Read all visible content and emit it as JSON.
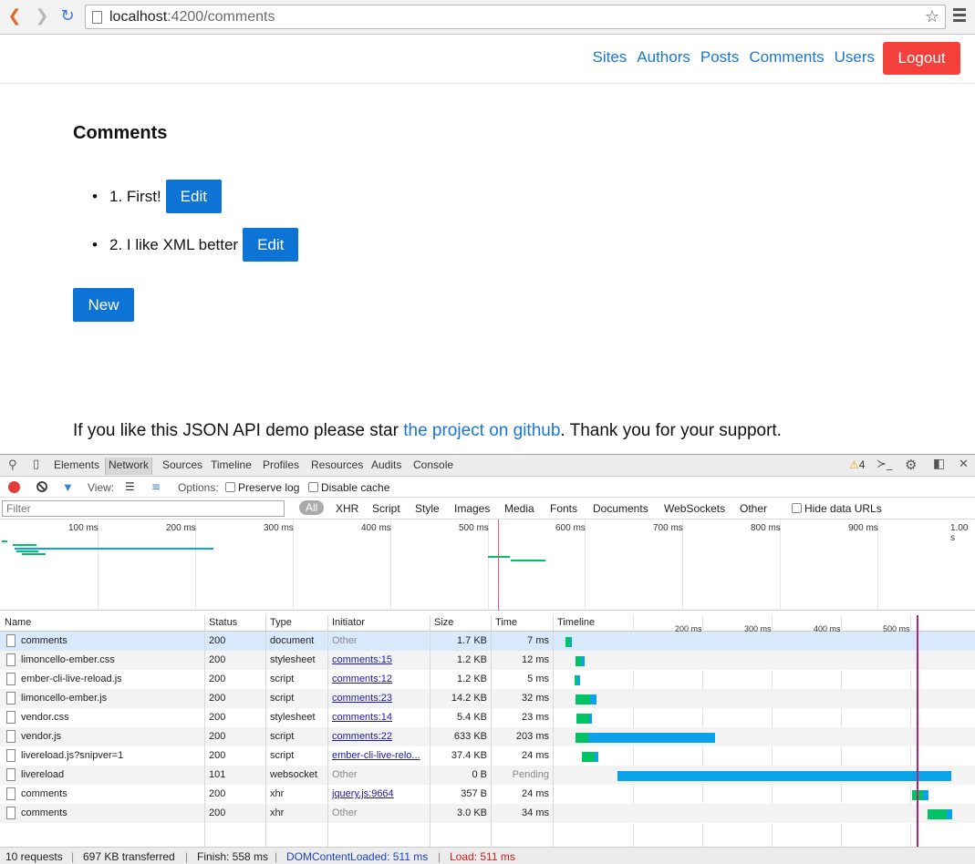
{
  "browser": {
    "url_host": "localhost",
    "url_path": ":4200/comments"
  },
  "navbar": {
    "links": [
      "Sites",
      "Authors",
      "Posts",
      "Comments",
      "Users"
    ],
    "logout_label": "Logout"
  },
  "main": {
    "title": "Comments",
    "comments": [
      {
        "text": "1. First!",
        "edit_label": "Edit"
      },
      {
        "text": "2. I like XML better",
        "edit_label": "Edit"
      }
    ],
    "new_label": "New",
    "footer_before": "If you like this JSON API demo please star ",
    "footer_link": "the project on github",
    "footer_after": ". Thank you for your support."
  },
  "devtools": {
    "tabs": [
      "Elements",
      "Network",
      "Sources",
      "Timeline",
      "Profiles",
      "Resources",
      "Audits",
      "Console"
    ],
    "active_tab": "Network",
    "warning_count": "4",
    "toolbar": {
      "view_label": "View:",
      "options_label": "Options:",
      "preserve_log": "Preserve log",
      "disable_cache": "Disable cache"
    },
    "filter_placeholder": "Filter",
    "type_filters": [
      "All",
      "XHR",
      "Script",
      "Style",
      "Images",
      "Media",
      "Fonts",
      "Documents",
      "WebSockets",
      "Other"
    ],
    "hide_data_urls": "Hide data URLs",
    "overview_ticks": [
      "100 ms",
      "200 ms",
      "300 ms",
      "400 ms",
      "500 ms",
      "600 ms",
      "700 ms",
      "800 ms",
      "900 ms",
      "1.00 s"
    ],
    "columns": [
      "Name",
      "Status",
      "Type",
      "Initiator",
      "Size",
      "Time",
      "Timeline"
    ],
    "timeline_ticks": [
      "200 ms",
      "300 ms",
      "400 ms",
      "500 ms"
    ],
    "requests": [
      {
        "name": "comments",
        "status": "200",
        "type": "document",
        "initiator": "Other",
        "size": "1.7 KB",
        "time": "7 ms"
      },
      {
        "name": "limoncello-ember.css",
        "status": "200",
        "type": "stylesheet",
        "initiator": "comments:15",
        "size": "1.2 KB",
        "time": "12 ms"
      },
      {
        "name": "ember-cli-live-reload.js",
        "status": "200",
        "type": "script",
        "initiator": "comments:12",
        "size": "1.2 KB",
        "time": "5 ms"
      },
      {
        "name": "limoncello-ember.js",
        "status": "200",
        "type": "script",
        "initiator": "comments:23",
        "size": "14.2 KB",
        "time": "32 ms"
      },
      {
        "name": "vendor.css",
        "status": "200",
        "type": "stylesheet",
        "initiator": "comments:14",
        "size": "5.4 KB",
        "time": "23 ms"
      },
      {
        "name": "vendor.js",
        "status": "200",
        "type": "script",
        "initiator": "comments:22",
        "size": "633 KB",
        "time": "203 ms"
      },
      {
        "name": "livereload.js?snipver=1",
        "status": "200",
        "type": "script",
        "initiator": "ember-cli-live-relo...",
        "size": "37.4 KB",
        "time": "24 ms"
      },
      {
        "name": "livereload",
        "status": "101",
        "type": "websocket",
        "initiator": "Other",
        "size": "0 B",
        "time": "Pending"
      },
      {
        "name": "comments",
        "status": "200",
        "type": "xhr",
        "initiator": "jquery.js:9664",
        "size": "357 B",
        "time": "24 ms"
      },
      {
        "name": "comments",
        "status": "200",
        "type": "xhr",
        "initiator": "Other",
        "size": "3.0 KB",
        "time": "34 ms"
      }
    ],
    "status": {
      "requests": "10 requests",
      "transferred": "697 KB transferred",
      "finish": "Finish: 558 ms",
      "dom_loaded": "DOMContentLoaded: 511 ms",
      "load": "Load: 511 ms"
    }
  },
  "colors": {
    "link": "#1b77d3",
    "primary_button": "#0d74d6",
    "logout_button": "#f3403b",
    "waiting_bar": "#00c464",
    "receiving_bar": "#0aa3ea"
  }
}
